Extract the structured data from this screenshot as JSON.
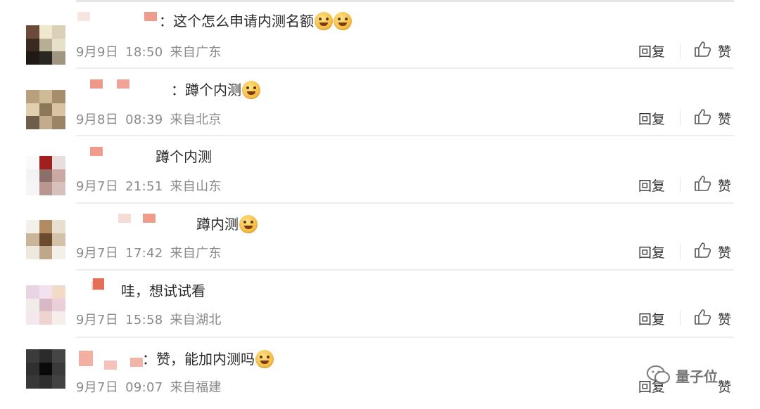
{
  "comments": [
    {
      "text": "：这个怎么申请内测名额",
      "emoji_count": 2,
      "date": "9月9日",
      "time": "18:50",
      "location": "来自广东"
    },
    {
      "text": "：蹲个内测",
      "emoji_count": 1,
      "date": "9月8日",
      "time": "08:39",
      "location": "来自北京"
    },
    {
      "text": "蹲个内测",
      "emoji_count": 0,
      "date": "9月7日",
      "time": "21:51",
      "location": "来自山东"
    },
    {
      "text": "蹲内测",
      "emoji_count": 1,
      "date": "9月7日",
      "time": "17:42",
      "location": "来自广东"
    },
    {
      "text": "哇，想试试看",
      "emoji_count": 0,
      "date": "9月7日",
      "time": "15:58",
      "location": "来自湖北"
    },
    {
      "text": "：赞，能加内测吗",
      "emoji_count": 1,
      "date": "9月7日",
      "time": "09:07",
      "location": "来自福建"
    }
  ],
  "actions": {
    "reply_label": "回复",
    "like_label": "赞"
  },
  "watermark": {
    "text": "量子位"
  },
  "colors": {
    "meta_gray": "#8a8a8a",
    "divider": "#ededed",
    "blurred_name": "#f0a79a"
  }
}
